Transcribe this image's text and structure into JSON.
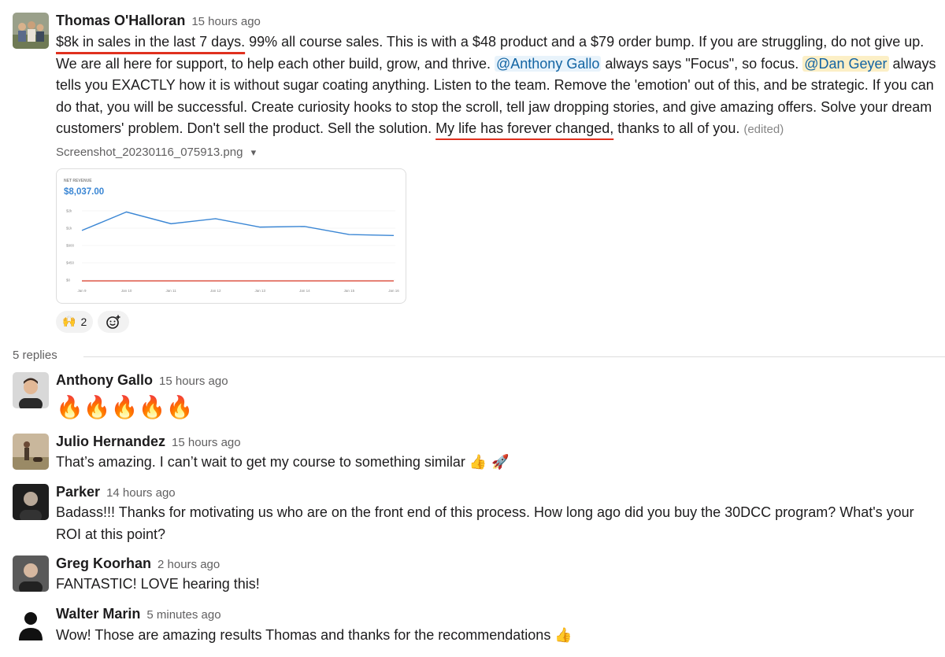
{
  "parent": {
    "author": "Thomas O'Halloran",
    "time": "15 hours ago",
    "lines": [
      {
        "a": "$8k in sales in the last 7 days.",
        "b": " 99% all course sales. This is with a $48 product and a $79 order bump. If you are struggling, do not give up."
      },
      {
        "a": "We are all here for support, to help each other build, grow, and thrive. ",
        "m1": "@Anthony Gallo",
        "b": " always says \"Focus\", so focus. ",
        "m2": "@Dan Geyer",
        "c": " always"
      },
      {
        "a": "tells you EXACTLY how it is without sugar coating anything. Listen to the team. Remove the 'emotion' out of this, and be strategic. If you can"
      },
      {
        "a": "do that, you will be successful. Create curiosity hooks to stop the scroll, tell jaw dropping stories, and give amazing offers. Solve your dream"
      },
      {
        "a": "customers' problem. Don't sell the product. Sell the solution. ",
        "u": "My life has forever changed,",
        "b": " thanks to all of you. ",
        "edited": "(edited)"
      }
    ],
    "file_name": "Screenshot_20230116_075913.png",
    "file_caret": "▾",
    "reactions": [
      {
        "emoji": "🙌",
        "count": "2"
      }
    ],
    "add_reaction_icon": "add-emoji-icon"
  },
  "chart_data": {
    "type": "line",
    "title": "NET REVENUE",
    "subtitle": "$8,037.00",
    "categories": [
      "Jan 9",
      "Jan 10",
      "Jan 11",
      "Jan 12",
      "Jan 13",
      "Jan 14",
      "Jan 15",
      "Jan 16"
    ],
    "y_ticks": [
      "$2k",
      "$1k",
      "$900",
      "$450",
      "$0"
    ],
    "series": [
      {
        "values": [
          1500,
          2050,
          1700,
          1850,
          1600,
          1620,
          1380,
          1350
        ],
        "color": "#3a86d4"
      },
      {
        "values": [
          0,
          0,
          0,
          0,
          0,
          0,
          0,
          0
        ],
        "color": "#e05a4a"
      }
    ],
    "grid": true,
    "ylim": [
      0,
      2200
    ]
  },
  "replies_label": "5 replies",
  "replies": [
    {
      "author": "Anthony Gallo",
      "time": "15 hours ago",
      "text": "🔥🔥🔥🔥🔥"
    },
    {
      "author": "Julio Hernandez",
      "time": "15 hours ago",
      "text": "That’s amazing. I can’t wait to get my course to something similar",
      "emoji": "👍 🚀"
    },
    {
      "author": "Parker",
      "time": "14 hours ago",
      "text": "Badass!!! Thanks for motivating us who are on the front end of this process. How long ago did you buy the 30DCC program? What's your",
      "text2": "ROI at this point?"
    },
    {
      "author": "Greg Koorhan",
      "time": "2 hours ago",
      "text": "FANTASTIC! LOVE hearing this!"
    },
    {
      "author": "Walter Marin",
      "time": "5 minutes ago",
      "text": "Wow! Those are amazing results Thomas and thanks for the recommendations",
      "emoji": "👍"
    }
  ]
}
